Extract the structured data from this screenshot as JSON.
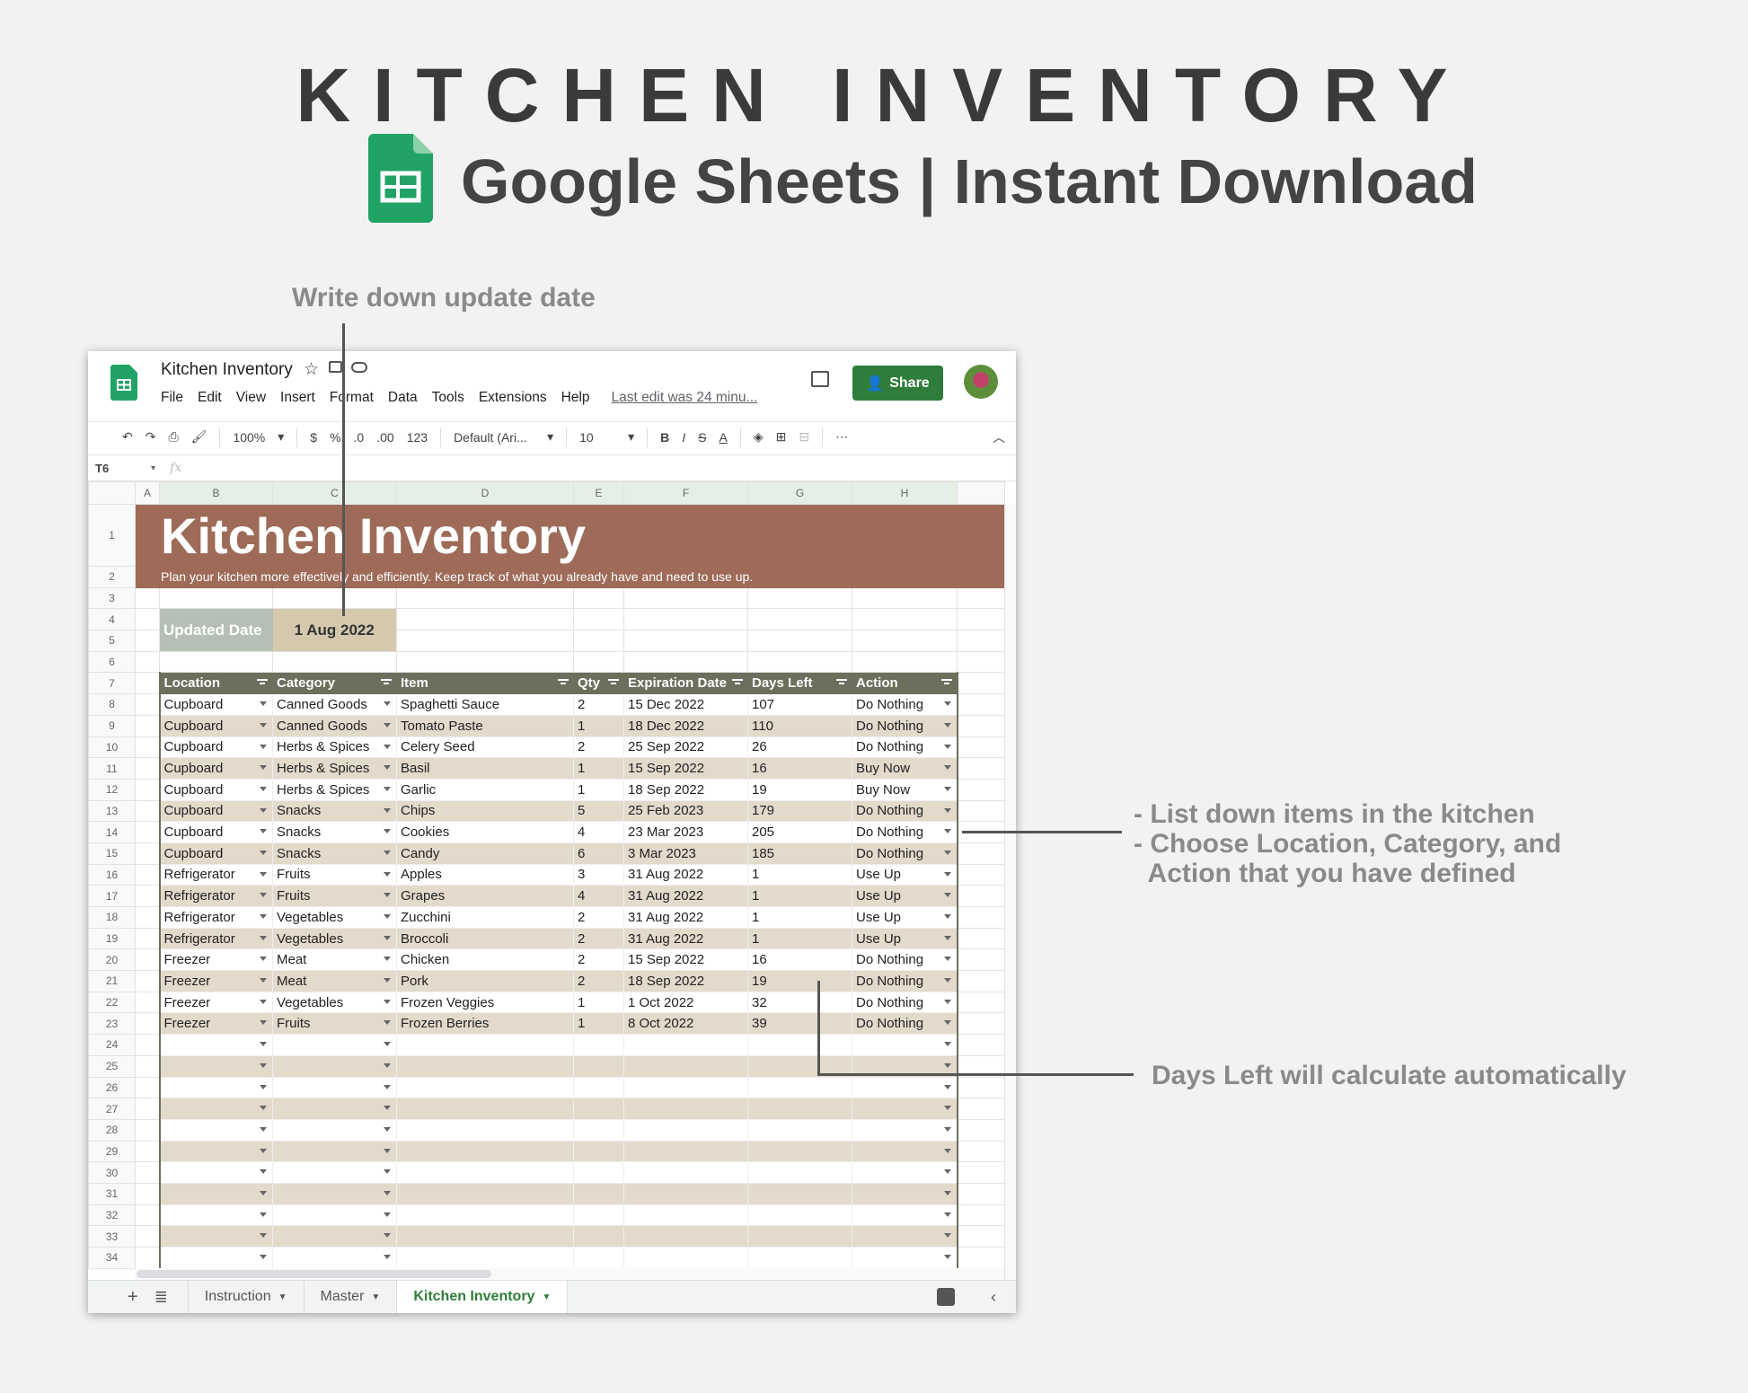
{
  "hero": {
    "title": "KITCHEN INVENTORY",
    "subtitle": "Google Sheets | Instant Download"
  },
  "annotations": {
    "update_date": "Write down update date",
    "list_items": [
      "- List down items in the kitchen",
      "- Choose Location, Category, and",
      "  Action that you have defined"
    ],
    "days_left": "Days Left will calculate automatically"
  },
  "app": {
    "doc_title": "Kitchen Inventory",
    "menu": [
      "File",
      "Edit",
      "View",
      "Insert",
      "Format",
      "Data",
      "Tools",
      "Extensions",
      "Help"
    ],
    "last_edit": "Last edit was 24 minu...",
    "share": "Share",
    "toolbar": {
      "zoom": "100%",
      "currency": "$",
      "percent": "%",
      "dec_less": ".0",
      "dec_more": ".00",
      "format": "123",
      "font": "Default (Ari...",
      "size": "10",
      "bold": "B",
      "italic": "I",
      "strike": "S",
      "color": "A",
      "more": "⋯"
    },
    "cell_ref": "T6",
    "fx": "fx"
  },
  "columns": [
    "A",
    "B",
    "C",
    "D",
    "E",
    "F",
    "G",
    "H",
    ""
  ],
  "row_numbers": [
    "1",
    "2",
    "3",
    "4",
    "5",
    "6",
    "7",
    "8",
    "9",
    "10",
    "11",
    "12",
    "13",
    "14",
    "15",
    "16",
    "17",
    "18",
    "19",
    "20",
    "21",
    "22",
    "23",
    "24",
    "25",
    "26",
    "27",
    "28",
    "29",
    "30",
    "31",
    "32",
    "33",
    "34"
  ],
  "sheet": {
    "title": "Kitchen Inventory",
    "subtitle": "Plan your kitchen more effectively and efficiently. Keep track of what you already have and need to use up.",
    "updated_label": "Updated Date",
    "updated_value": "1 Aug 2022",
    "headers": [
      "Location",
      "Category",
      "Item",
      "Qty",
      "Expiration Date",
      "Days Left",
      "Action"
    ],
    "rows": [
      [
        "Cupboard",
        "Canned Goods",
        "Spaghetti Sauce",
        "2",
        "15 Dec 2022",
        "107",
        "Do Nothing"
      ],
      [
        "Cupboard",
        "Canned Goods",
        "Tomato Paste",
        "1",
        "18 Dec 2022",
        "110",
        "Do Nothing"
      ],
      [
        "Cupboard",
        "Herbs & Spices",
        "Celery Seed",
        "2",
        "25 Sep 2022",
        "26",
        "Do Nothing"
      ],
      [
        "Cupboard",
        "Herbs & Spices",
        "Basil",
        "1",
        "15 Sep 2022",
        "16",
        "Buy Now"
      ],
      [
        "Cupboard",
        "Herbs & Spices",
        "Garlic",
        "1",
        "18 Sep 2022",
        "19",
        "Buy Now"
      ],
      [
        "Cupboard",
        "Snacks",
        "Chips",
        "5",
        "25 Feb 2023",
        "179",
        "Do Nothing"
      ],
      [
        "Cupboard",
        "Snacks",
        "Cookies",
        "4",
        "23 Mar 2023",
        "205",
        "Do Nothing"
      ],
      [
        "Cupboard",
        "Snacks",
        "Candy",
        "6",
        "3 Mar 2023",
        "185",
        "Do Nothing"
      ],
      [
        "Refrigerator",
        "Fruits",
        "Apples",
        "3",
        "31 Aug 2022",
        "1",
        "Use Up"
      ],
      [
        "Refrigerator",
        "Fruits",
        "Grapes",
        "4",
        "31 Aug 2022",
        "1",
        "Use Up"
      ],
      [
        "Refrigerator",
        "Vegetables",
        "Zucchini",
        "2",
        "31 Aug 2022",
        "1",
        "Use Up"
      ],
      [
        "Refrigerator",
        "Vegetables",
        "Broccoli",
        "2",
        "31 Aug 2022",
        "1",
        "Use Up"
      ],
      [
        "Freezer",
        "Meat",
        "Chicken",
        "2",
        "15 Sep 2022",
        "16",
        "Do Nothing"
      ],
      [
        "Freezer",
        "Meat",
        "Pork",
        "2",
        "18 Sep 2022",
        "19",
        "Do Nothing"
      ],
      [
        "Freezer",
        "Vegetables",
        "Frozen Veggies",
        "1",
        "1 Oct 2022",
        "32",
        "Do Nothing"
      ],
      [
        "Freezer",
        "Fruits",
        "Frozen Berries",
        "1",
        "8 Oct 2022",
        "39",
        "Do Nothing"
      ]
    ]
  },
  "tabs": [
    "Instruction",
    "Master",
    "Kitchen Inventory"
  ],
  "colors": {
    "banner": "#9e6b58",
    "header": "#6b705c",
    "alt_row": "#e3dacb",
    "share": "#2f7d3a"
  }
}
